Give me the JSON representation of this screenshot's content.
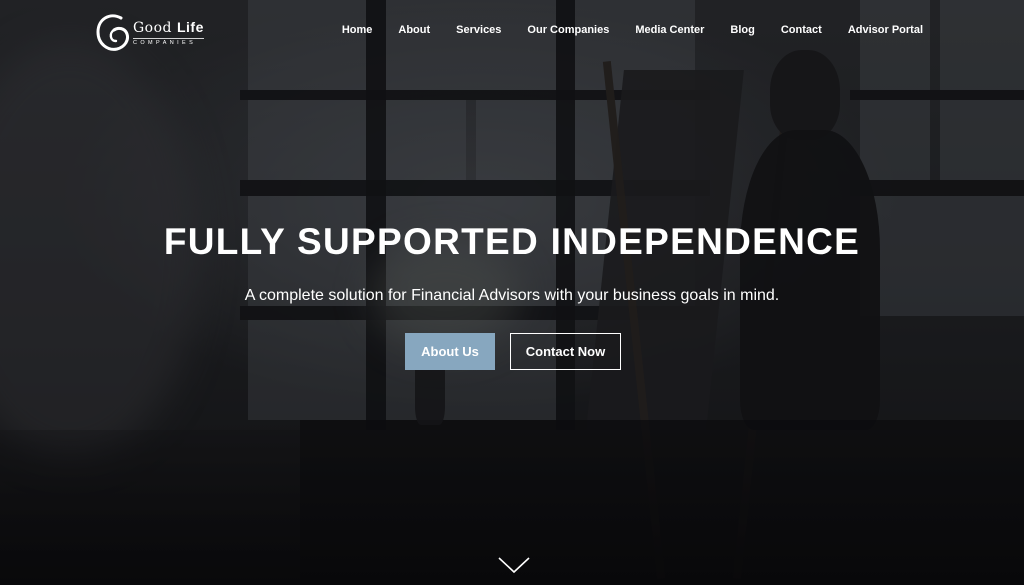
{
  "brand": {
    "name_regular": "Good",
    "name_bold": "Life",
    "subtitle": "COMPANIES"
  },
  "nav": {
    "items": [
      {
        "label": "Home"
      },
      {
        "label": "About"
      },
      {
        "label": "Services"
      },
      {
        "label": "Our Companies"
      },
      {
        "label": "Media Center"
      },
      {
        "label": "Blog"
      },
      {
        "label": "Contact"
      },
      {
        "label": "Advisor Portal"
      }
    ]
  },
  "hero": {
    "headline": "FULLY SUPPORTED INDEPENDENCE",
    "subheadline": "A complete solution for Financial Advisors with your business goals in mind.",
    "primary_button": "About Us",
    "secondary_button": "Contact Now",
    "scroll_icon": "chevron-down-icon"
  },
  "colors": {
    "primary_button_bg": "#87a7bf",
    "text": "#ffffff"
  }
}
